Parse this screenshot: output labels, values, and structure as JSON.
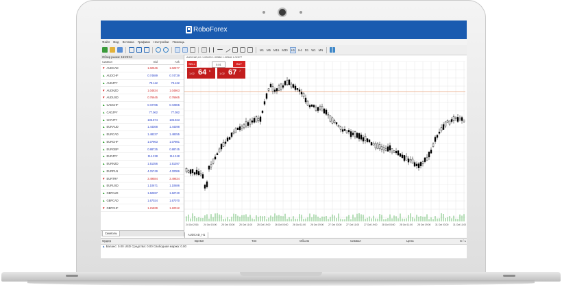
{
  "app": {
    "brand": "RoboForex"
  },
  "menu": [
    "Файл",
    "Вид",
    "Вставка",
    "Графики",
    "Настройки",
    "Помощь"
  ],
  "toolbar": {
    "timeframes": [
      "M1",
      "M5",
      "M15",
      "M30",
      "H1",
      "H4",
      "D1",
      "W1",
      "MN"
    ],
    "active_timeframe": "H1"
  },
  "market_watch": {
    "title": "Обзор рынка: 15:29:34",
    "columns": [
      "Символ",
      "Bid",
      "Ask"
    ],
    "rows": [
      {
        "symbol": "AUDCAD",
        "bid": "1.02546",
        "ask": "1.02577",
        "dir": "down"
      },
      {
        "symbol": "AUDCHF",
        "bid": "0.74689",
        "ask": "0.74739",
        "dir": "up"
      },
      {
        "symbol": "AUDJPY",
        "bid": "79.112",
        "ask": "79.132",
        "dir": "up"
      },
      {
        "symbol": "AUDNZD",
        "bid": "1.04834",
        "ask": "1.04863",
        "dir": "down"
      },
      {
        "symbol": "AUDUSD",
        "bid": "0.76645",
        "ask": "0.76665",
        "dir": "down"
      },
      {
        "symbol": "CADCHF",
        "bid": "0.72785",
        "ask": "0.72805",
        "dir": "up"
      },
      {
        "symbol": "CADJPY",
        "bid": "77.062",
        "ask": "77.082",
        "dir": "up"
      },
      {
        "symbol": "CHFJPY",
        "bid": "105.874",
        "ask": "105.923",
        "dir": "up"
      },
      {
        "symbol": "EURAUD",
        "bid": "1.44368",
        "ask": "1.44398",
        "dir": "up"
      },
      {
        "symbol": "EURCAD",
        "bid": "1.48237",
        "ask": "1.48255",
        "dir": "up"
      },
      {
        "symbol": "EURCHF",
        "bid": "1.07963",
        "ask": "1.07981",
        "dir": "up"
      },
      {
        "symbol": "EURGBP",
        "bid": "0.88725",
        "ask": "0.88745",
        "dir": "up"
      },
      {
        "symbol": "EURJPY",
        "bid": "114.228",
        "ask": "114.248",
        "dir": "up"
      },
      {
        "symbol": "EURNZD",
        "bid": "1.51356",
        "ask": "1.51397",
        "dir": "up"
      },
      {
        "symbol": "EURPLN",
        "bid": "4.31749",
        "ask": "4.32086",
        "dir": "up"
      },
      {
        "symbol": "EURTRY",
        "bid": "3.49584",
        "ask": "3.49834",
        "dir": "down"
      },
      {
        "symbol": "EURUSD",
        "bid": "1.10671",
        "ask": "1.10686",
        "dir": "up"
      },
      {
        "symbol": "GBPAUD",
        "bid": "1.62697",
        "ask": "1.62740",
        "dir": "up"
      },
      {
        "symbol": "GBPCAD",
        "bid": "1.67024",
        "ask": "1.67070",
        "dir": "up"
      },
      {
        "symbol": "GBPCHF",
        "bid": "1.21839",
        "ask": "1.22012",
        "dir": "down"
      }
    ],
    "tab": "Символы"
  },
  "chart": {
    "title": "AUDCAD,H1 1.02620 1.02588 1.02546 1.02577",
    "tab": "AUDCAD_H1",
    "sell_label": "SELL",
    "buy_label": "BUY",
    "lot": "0.01",
    "sell_small": "1.02",
    "sell_big": "64",
    "sell_sup": "6",
    "buy_small": "1.02",
    "buy_big": "67",
    "buy_sup": "7",
    "time_labels": [
      "24 Oct 2016",
      "24 Oct 15:00",
      "25 Oct 03:00",
      "25 Oct 11:00",
      "25 Oct 19:00",
      "26 Oct 03:00",
      "26 Oct 11:00",
      "26 Oct 19:00",
      "27 Oct 03:00",
      "27 Oct 11:00",
      "27 Oct 19:00",
      "28 Oct 03:00",
      "28 Oct 11:00",
      "28 Oct 19:00",
      "31 Oct 03:00",
      "31 Oct 11:00"
    ],
    "price_line_color": "#e8a07a",
    "candle_color": "#000000",
    "volume_color": "#4caf50"
  },
  "terminal": {
    "columns": [
      "Ордер",
      "Время",
      "Тип",
      "Объем",
      "Символ",
      "Цена",
      "S / L"
    ],
    "balance": "Баланс: 0.00 USD  Средства: 0.00  Свободная маржа: 0.00"
  }
}
